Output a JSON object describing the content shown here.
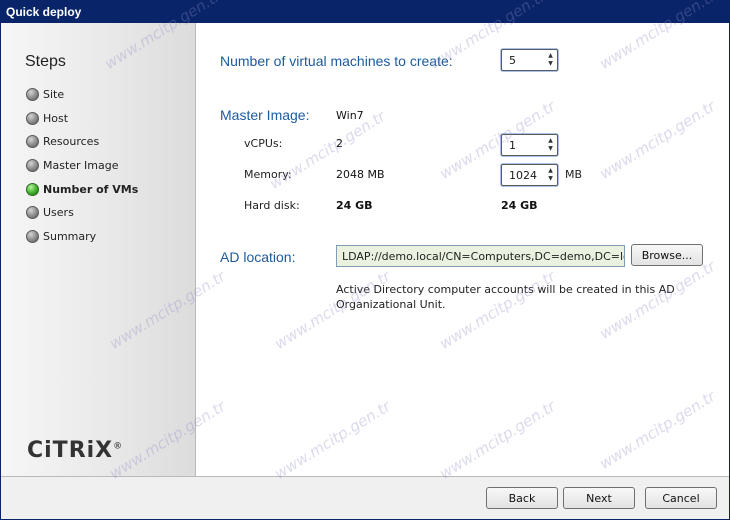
{
  "window": {
    "title": "Quick deploy"
  },
  "sidebar": {
    "title": "Steps",
    "steps": [
      {
        "label": "Site",
        "active": false
      },
      {
        "label": "Host",
        "active": false
      },
      {
        "label": "Resources",
        "active": false
      },
      {
        "label": "Master Image",
        "active": false
      },
      {
        "label": "Number of VMs",
        "active": true
      },
      {
        "label": "Users",
        "active": false
      },
      {
        "label": "Summary",
        "active": false
      }
    ],
    "logo": "CiTRiX",
    "logo_mark": "®"
  },
  "main": {
    "vm_count": {
      "label": "Number of virtual machines to create:",
      "value": "5"
    },
    "master_image": {
      "label": "Master Image:",
      "name": "Win7",
      "vcpus": {
        "label": "vCPUs:",
        "image_value": "2",
        "value": "1"
      },
      "memory": {
        "label": "Memory:",
        "image_value": "2048 MB",
        "value": "1024",
        "unit": "MB"
      },
      "hard_disk": {
        "label": "Hard disk:",
        "image_value": "24 GB",
        "value": "24 GB"
      }
    },
    "ad_location": {
      "label": "AD location:",
      "value": "LDAP://demo.local/CN=Computers,DC=demo,DC=local",
      "browse_label": "Browse...",
      "note": "Active Directory computer accounts will be created in this AD Organizational Unit."
    }
  },
  "footer": {
    "back_label": "Back",
    "next_label": "Next",
    "cancel_label": "Cancel"
  },
  "watermark": {
    "text": "www.mcitp.gen.tr"
  },
  "colors": {
    "titlebar": "#0a246a",
    "heading": "#1c5a9e",
    "active_step": "#3fae2c",
    "ad_field_bg": "#eaf2df"
  }
}
